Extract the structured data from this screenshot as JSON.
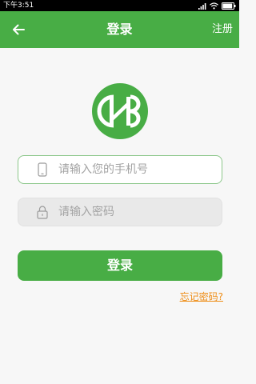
{
  "status_bar": {
    "time": "下午3:51",
    "battery_level": 0.9
  },
  "header": {
    "title": "登录",
    "right_action": "注册",
    "back_icon": "arrow-left-icon"
  },
  "form": {
    "phone_placeholder": "请输入您的手机号",
    "password_placeholder": "请输入密码",
    "phone_icon": "mobile-phone-icon",
    "password_icon": "lock-icon",
    "submit_label": "登录",
    "forgot_label": "忘记密码?"
  },
  "colors": {
    "brand_green": "#48ad45",
    "link_orange": "#ee8d17"
  }
}
